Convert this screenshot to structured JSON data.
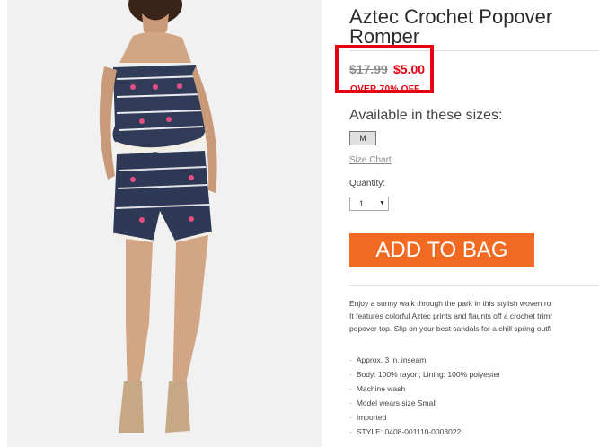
{
  "product": {
    "title_line1": "Aztec Crochet Popover",
    "title_line2": "Romper",
    "price_original": "$17.99",
    "price_sale": "$5.00",
    "price_note": "OVER 70% OFF",
    "sizes_label": "Available in these sizes:",
    "sizes": [
      "M"
    ],
    "size_chart_link": "Size Chart",
    "quantity_label": "Quantity:",
    "quantity_value": "1",
    "add_to_bag": "ADD TO BAG",
    "description_lines": [
      "Enjoy a sunny walk through the park in this stylish woven ro",
      "It features colorful Aztec prints and flaunts off a crochet trimr",
      "popover top. Slip on your best sandals for a chill spring outfi"
    ],
    "features": [
      "Approx. 3 in. inseam",
      "Body: 100% rayon; Lining: 100% polyester",
      "Machine wash",
      "Model wears size Small",
      "Imported",
      "STYLE: 0408-001110-0003022"
    ]
  },
  "colors": {
    "sale_red": "#e60012",
    "add_button_orange": "#f26a21"
  }
}
